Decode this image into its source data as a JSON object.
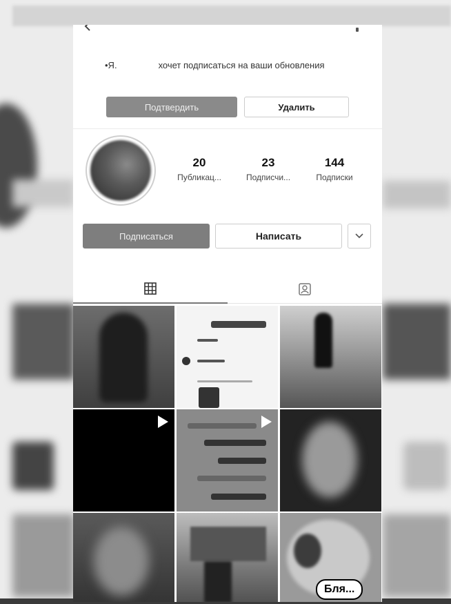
{
  "follow_request": {
    "text_prefix": "•Я.",
    "text": "хочет подписаться на ваши обновления",
    "confirm_label": "Подтвердить",
    "delete_label": "Удалить"
  },
  "profile": {
    "stats": [
      {
        "value": "20",
        "label": "Публикац..."
      },
      {
        "value": "23",
        "label": "Подписчи..."
      },
      {
        "value": "144",
        "label": "Подписки"
      }
    ],
    "follow_label": "Подписаться",
    "message_label": "Написать"
  },
  "tabs": [
    {
      "name": "grid",
      "icon": "grid-icon",
      "active": true
    },
    {
      "name": "tagged",
      "icon": "tagged-photo-icon",
      "active": false
    }
  ],
  "posts": {
    "video_icon": "play-icon",
    "meme_caption": "Бля..."
  }
}
